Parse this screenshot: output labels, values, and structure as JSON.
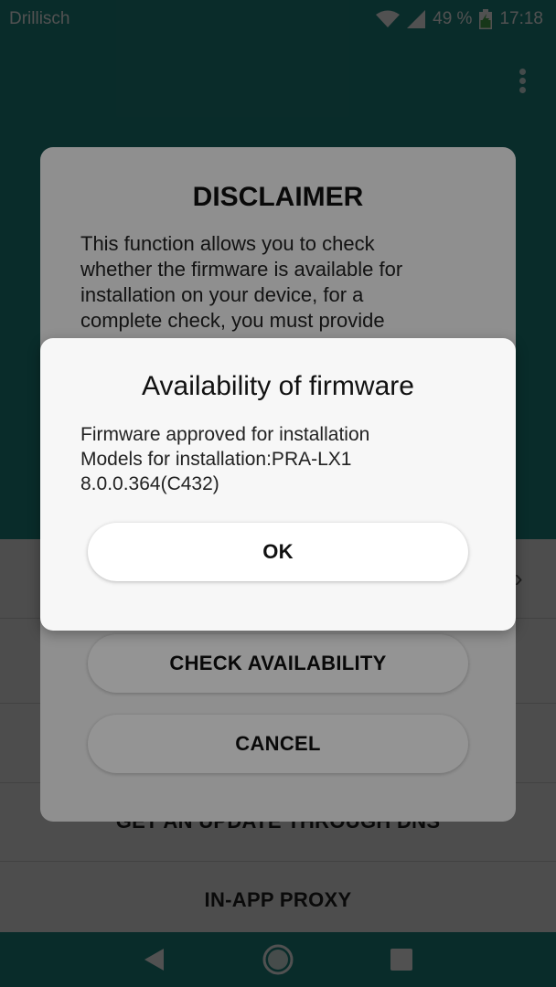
{
  "status_bar": {
    "carrier": "Drillisch",
    "battery": "49 %",
    "time": "17:18"
  },
  "list": {
    "items": [
      {
        "label": ""
      },
      {
        "label": ""
      },
      {
        "label": ""
      },
      {
        "label": "GET AN UPDATE THROUGH DNS"
      },
      {
        "label": "IN-APP PROXY"
      }
    ]
  },
  "disclaimer": {
    "title": "DISCLAIMER",
    "body": "This function allows you to check whether the firmware is available for installation on your device, for a complete check, you must provide",
    "check_label": "CHECK AVAILABILITY",
    "cancel_label": "CANCEL"
  },
  "availability_dialog": {
    "title": "Availability of firmware",
    "lines": [
      "Firmware approved for installation",
      "Models for installation:PRA-LX1",
      "8.0.0.364(C432)"
    ],
    "ok_label": "OK"
  },
  "icons": {
    "wifi": "wifi-icon",
    "signal": "signal-icon",
    "battery": "battery-charging-icon",
    "menu": "more-vert-icon",
    "back": "back-icon",
    "home": "home-icon",
    "recents": "recents-icon",
    "chevron": "chevron-right-icon"
  },
  "colors": {
    "teal": "#1f8a85",
    "battery_green": "#4caf50"
  }
}
